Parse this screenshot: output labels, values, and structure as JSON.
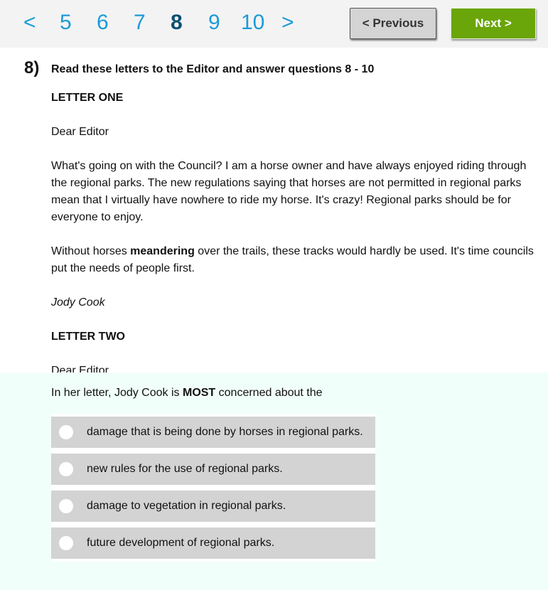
{
  "pager": {
    "prev_arrow": "<",
    "next_arrow": ">",
    "pages": [
      "5",
      "6",
      "7",
      "8",
      "9",
      "10"
    ],
    "current_page": "8"
  },
  "nav": {
    "previous_label": "< Previous",
    "next_label": "Next >",
    "next_color": "#6aa509"
  },
  "question": {
    "number": "8)",
    "instruction": "Read these letters to the Editor and answer questions 8 - 10",
    "passage": {
      "letter_one_heading": "LETTER ONE",
      "salutation": "Dear Editor",
      "para1": "What's going on with the Council? I am a horse owner and have always enjoyed riding through the regional parks. The new regulations saying that horses are not permitted in regional parks mean that I virtually have nowhere to ride my horse. It's crazy! Regional parks should be for everyone to enjoy.",
      "para2_before": "Without horses ",
      "para2_bold": "meandering",
      "para2_after": " over the trails, these tracks would hardly be used. It's time councils put the needs of people first.",
      "signature": "Jody Cook",
      "letter_two_heading": "LETTER TWO",
      "salutation2": "Dear Editor"
    },
    "stem_before": "In her letter, Jody Cook is ",
    "stem_bold": "MOST",
    "stem_after": " concerned about the",
    "options": [
      {
        "label": "damage that is being done by horses in regional parks."
      },
      {
        "label": "new rules for the use of regional parks."
      },
      {
        "label": "damage to vegetation in regional parks."
      },
      {
        "label": "future development of regional parks."
      }
    ]
  }
}
